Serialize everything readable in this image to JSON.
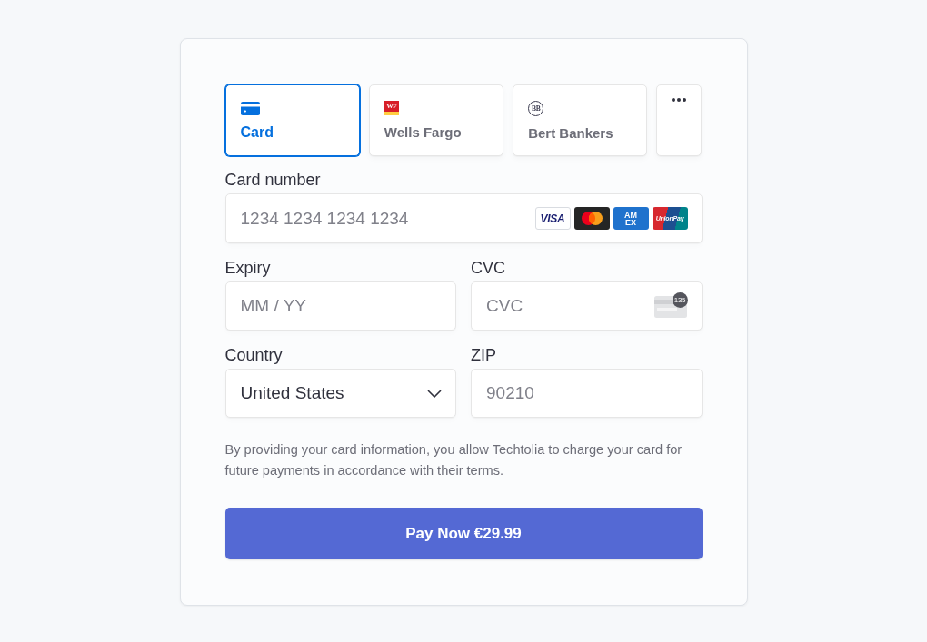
{
  "payment_methods": [
    {
      "kind": "card",
      "label": "Card",
      "selected": true
    },
    {
      "kind": "bank",
      "label": "Wells Fargo",
      "logo": {
        "kind": "tile",
        "text": "WF"
      },
      "selected": false
    },
    {
      "kind": "bank",
      "label": "Bert Bankers",
      "logo": {
        "kind": "circle",
        "text": "BB"
      },
      "selected": false
    },
    {
      "kind": "more",
      "selected": false
    }
  ],
  "card_number": {
    "label": "Card number",
    "placeholder": "1234 1234 1234 1234",
    "brands": [
      {
        "kind": "visa",
        "text": "VISA"
      },
      {
        "kind": "mastercard"
      },
      {
        "kind": "amex",
        "text": "AMEX"
      },
      {
        "kind": "unionpay",
        "text": "UnionPay"
      }
    ]
  },
  "expiry": {
    "label": "Expiry",
    "placeholder": "MM / YY"
  },
  "cvc": {
    "label": "CVC",
    "placeholder": "CVC",
    "code_badge": "135"
  },
  "country": {
    "label": "Country",
    "value": "United States"
  },
  "zip": {
    "label": "ZIP",
    "placeholder": "90210"
  },
  "notice": "By providing your card information, you allow Techtolia to charge your card for future payments in accordance with their terms.",
  "pay_button": "Pay Now €29.99"
}
